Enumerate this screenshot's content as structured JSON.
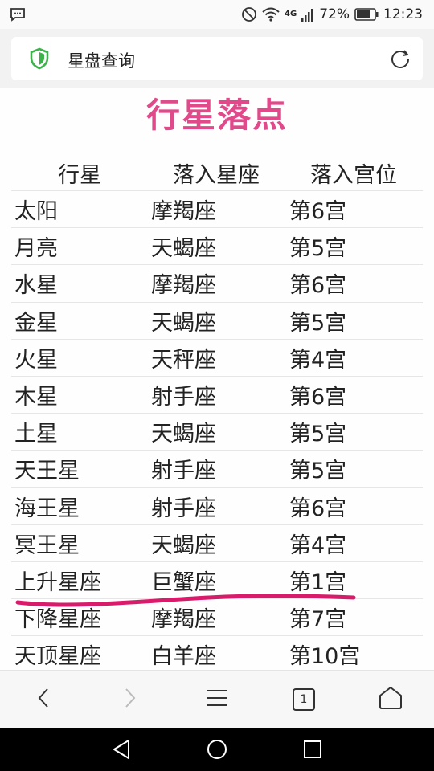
{
  "status_bar": {
    "battery_percent": "72%",
    "time": "12:23",
    "network": "4G",
    "icons": [
      "message-icon",
      "mute-icon",
      "wifi-icon",
      "signal-icon",
      "battery-icon"
    ]
  },
  "address_bar": {
    "title": "星盘查询",
    "icons": [
      "shield-icon",
      "reload-icon"
    ]
  },
  "page": {
    "title": "行星落点",
    "title_color": "#e04a8a",
    "table": {
      "headers": [
        "行星",
        "落入星座",
        "落入宫位"
      ],
      "rows": [
        [
          "太阳",
          "摩羯座",
          "第6宫"
        ],
        [
          "月亮",
          "天蝎座",
          "第5宫"
        ],
        [
          "水星",
          "摩羯座",
          "第6宫"
        ],
        [
          "金星",
          "天蝎座",
          "第5宫"
        ],
        [
          "火星",
          "天秤座",
          "第4宫"
        ],
        [
          "木星",
          "射手座",
          "第6宫"
        ],
        [
          "土星",
          "天蝎座",
          "第5宫"
        ],
        [
          "天王星",
          "射手座",
          "第5宫"
        ],
        [
          "海王星",
          "射手座",
          "第6宫"
        ],
        [
          "冥王星",
          "天蝎座",
          "第4宫"
        ],
        [
          "上升星座",
          "巨蟹座",
          "第1宫"
        ],
        [
          "下降星座",
          "摩羯座",
          "第7宫"
        ],
        [
          "天顶星座",
          "白羊座",
          "第10宫"
        ]
      ]
    },
    "annotation_color": "#d81b6a"
  },
  "browser_nav": {
    "tab_count": "1",
    "icons": [
      "back-icon",
      "forward-icon",
      "menu-icon",
      "tabs-icon",
      "home-icon"
    ]
  },
  "android_nav": {
    "icons": [
      "android-back-icon",
      "android-home-icon",
      "android-recents-icon"
    ]
  }
}
